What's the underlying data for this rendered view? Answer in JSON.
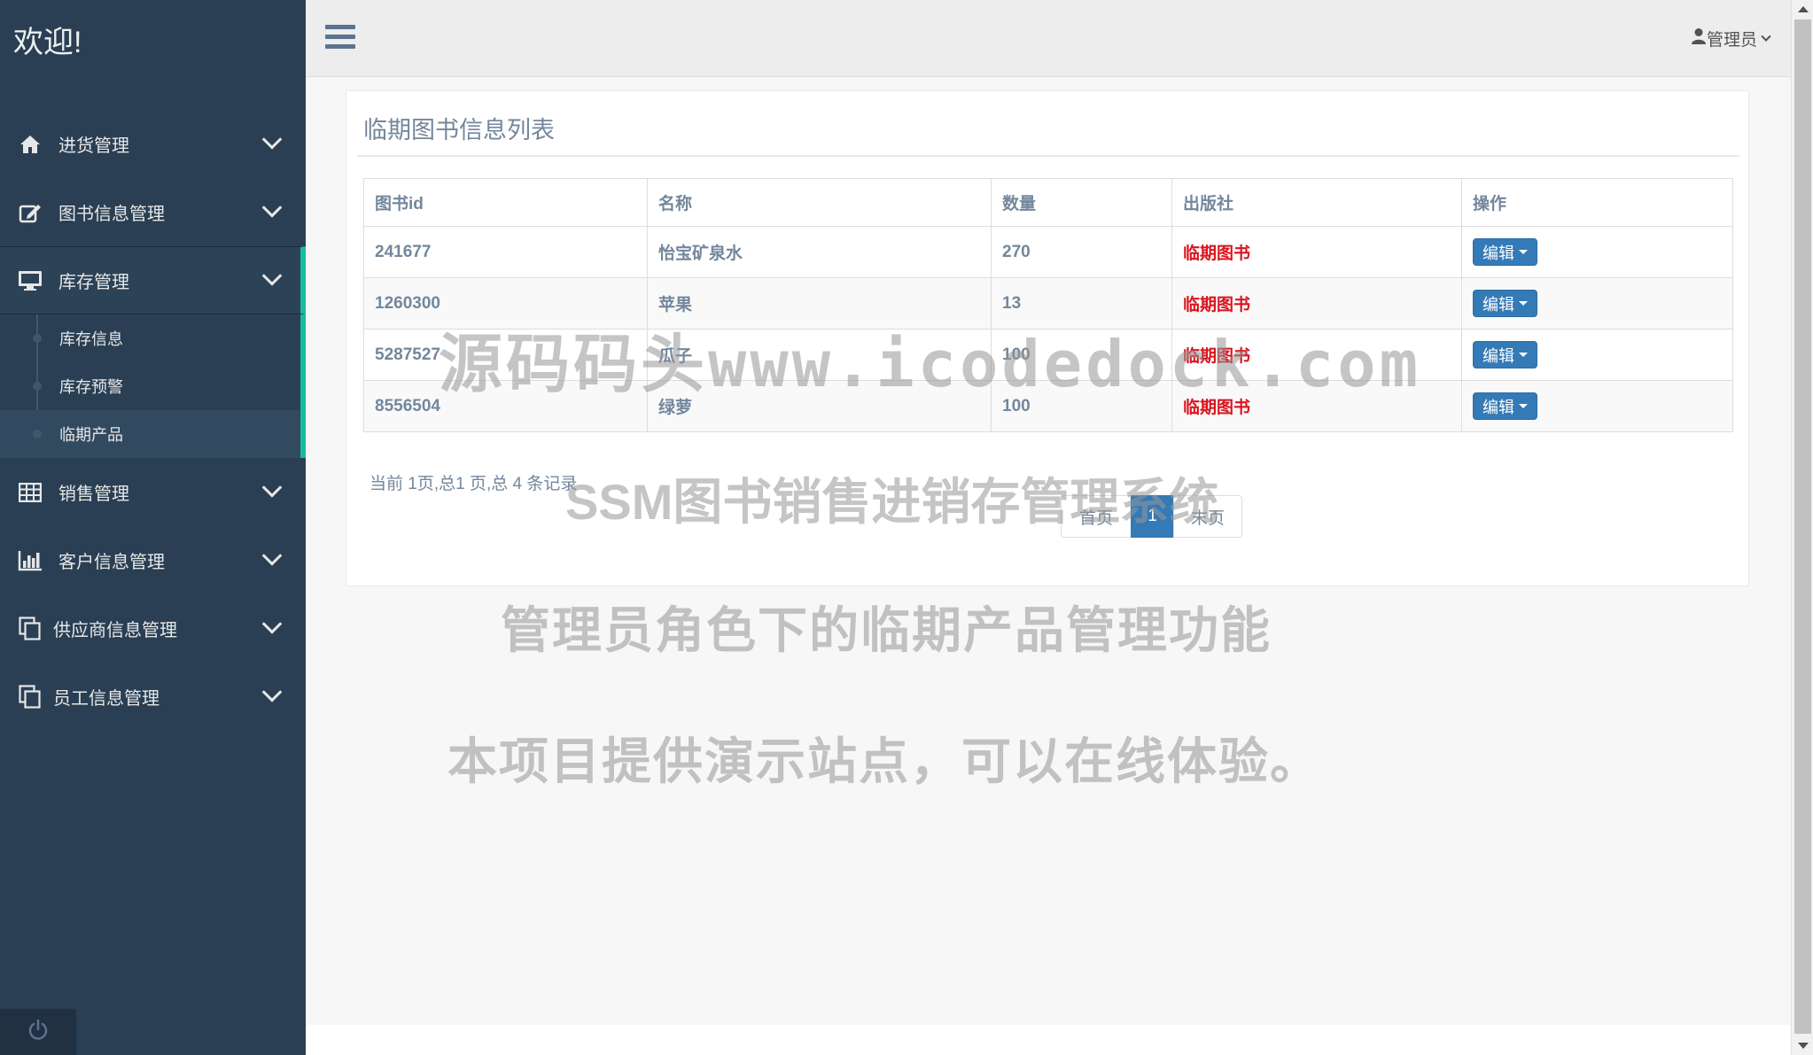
{
  "sidebar": {
    "brand": "欢迎!",
    "menu": [
      {
        "label": "进货管理",
        "icon": "home-icon"
      },
      {
        "label": "图书信息管理",
        "icon": "edit-icon"
      },
      {
        "label": "库存管理",
        "icon": "desktop-icon"
      },
      {
        "label": "销售管理",
        "icon": "table-icon"
      },
      {
        "label": "客户信息管理",
        "icon": "bar-chart-icon"
      },
      {
        "label": "供应商信息管理",
        "icon": "copy-icon"
      },
      {
        "label": "员工信息管理",
        "icon": "copy-icon"
      }
    ],
    "submenu": [
      "库存信息",
      "库存预警",
      "临期产品"
    ],
    "active_submenu": "临期产品"
  },
  "topnav": {
    "user": "管理员"
  },
  "panel": {
    "title": "临期图书信息列表",
    "columns": [
      "图书id",
      "名称",
      "数量",
      "出版社",
      "操作"
    ],
    "rows": [
      {
        "id": "241677",
        "name": "怡宝矿泉水",
        "qty": "270",
        "publisher": "临期图书",
        "action": "编辑"
      },
      {
        "id": "1260300",
        "name": "苹果",
        "qty": "13",
        "publisher": "临期图书",
        "action": "编辑"
      },
      {
        "id": "5287527",
        "name": "瓜子",
        "qty": "100",
        "publisher": "临期图书",
        "action": "编辑"
      },
      {
        "id": "8556504",
        "name": "绿萝",
        "qty": "100",
        "publisher": "临期图书",
        "action": "编辑"
      }
    ],
    "page_info": "当前 1页,总1 页,总 4 条记录",
    "pager": {
      "first": "首页",
      "current": "1",
      "last": "末页"
    }
  },
  "watermarks": [
    "源码码头www.icodedock.com",
    "SSM图书销售进销存管理系统",
    "管理员角色下的临期产品管理功能",
    "本项目提供演示站点，可以在线体验。"
  ],
  "colors": {
    "sidebar_bg": "#2a3f54",
    "accent": "#1abb9c",
    "primary_button": "#337ab7",
    "publisher_text": "#d9141e"
  }
}
